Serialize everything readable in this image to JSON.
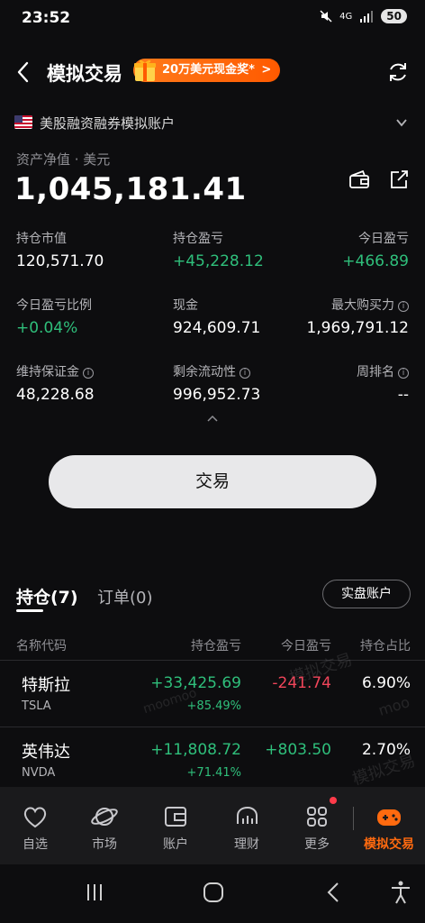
{
  "status_bar": {
    "time": "23:52",
    "signal_text": "4G",
    "battery": "50"
  },
  "header": {
    "title": "模拟交易",
    "promo_label": "20万美元现金奖*",
    "promo_arrow": ">"
  },
  "account": {
    "name": "美股融资融券模拟账户",
    "net_asset_label": "资产净值 · 美元",
    "net_asset_value": "1,045,181.41"
  },
  "metrics": {
    "position_value_label": "持仓市值",
    "position_value": "120,571.70",
    "position_pl_label": "持仓盈亏",
    "position_pl": "+45,228.12",
    "today_pl_label": "今日盈亏",
    "today_pl": "+466.89",
    "today_pl_ratio_label": "今日盈亏比例",
    "today_pl_ratio": "+0.04%",
    "cash_label": "现金",
    "cash": "924,609.71",
    "max_buying_power_label": "最大购买力",
    "max_buying_power": "1,969,791.12",
    "maintenance_margin_label": "维持保证金",
    "maintenance_margin": "48,228.68",
    "remaining_liquidity_label": "剩余流动性",
    "remaining_liquidity": "996,952.73",
    "weekly_rank_label": "周排名",
    "weekly_rank": "--"
  },
  "trade_button": "交易",
  "tabs": {
    "positions": "持仓(7)",
    "orders": "订单(0)",
    "real_account": "实盘账户"
  },
  "table": {
    "headers": [
      "名称代码",
      "持仓盈亏",
      "今日盈亏",
      "持仓占比"
    ],
    "rows": [
      {
        "name": "特斯拉",
        "code": "TSLA",
        "pl": "+33,425.69",
        "pl_pct": "+85.49%",
        "today": "-241.74",
        "share": "6.90%"
      },
      {
        "name": "英伟达",
        "code": "NVDA",
        "pl": "+11,808.72",
        "pl_pct": "+71.41%",
        "today": "+803.50",
        "share": "2.70%"
      }
    ]
  },
  "watermarks": [
    "模拟交易",
    "模拟交易",
    "moomoo",
    "moo"
  ],
  "bottom_nav": [
    {
      "label": "自选",
      "icon": "heart-icon"
    },
    {
      "label": "市场",
      "icon": "planet-icon"
    },
    {
      "label": "账户",
      "icon": "wallet-icon"
    },
    {
      "label": "理财",
      "icon": "piggy-bank-icon"
    },
    {
      "label": "更多",
      "icon": "grid-icon"
    },
    {
      "label": "模拟交易",
      "icon": "gamepad-icon"
    }
  ],
  "colors": {
    "gain": "#2fbf7b",
    "loss": "#f0455a",
    "accent": "#ff6a0f",
    "background": "#0d0d0f"
  }
}
